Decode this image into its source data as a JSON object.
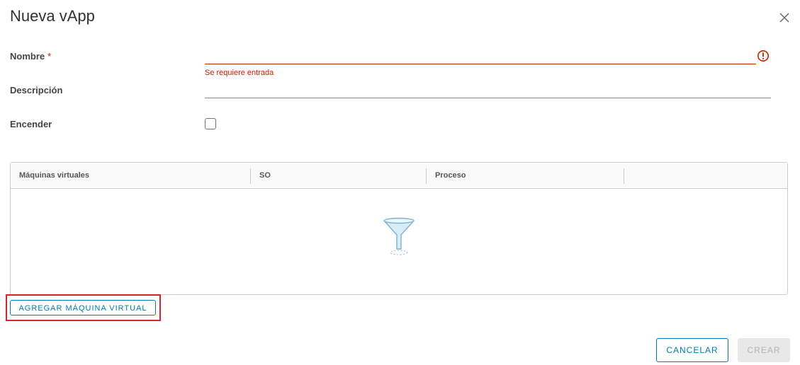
{
  "dialog": {
    "title": "Nueva vApp"
  },
  "form": {
    "name_label": "Nombre",
    "required_marker": "*",
    "name_value": "",
    "name_error": "Se requiere entrada",
    "description_label": "Descripción",
    "description_value": "",
    "power_on_label": "Encender",
    "power_on_checked": false
  },
  "vm_grid": {
    "columns": [
      "Máquinas virtuales",
      "SO",
      "Proceso"
    ],
    "rows": [],
    "empty_icon": "funnel-icon"
  },
  "actions": {
    "add_vm_label": "AGREGAR MÁQUINA VIRTUAL",
    "cancel_label": "CANCELAR",
    "create_label": "CREAR"
  },
  "colors": {
    "accent": "#0079b8",
    "error": "#c92100",
    "highlight": "#d9232e"
  }
}
